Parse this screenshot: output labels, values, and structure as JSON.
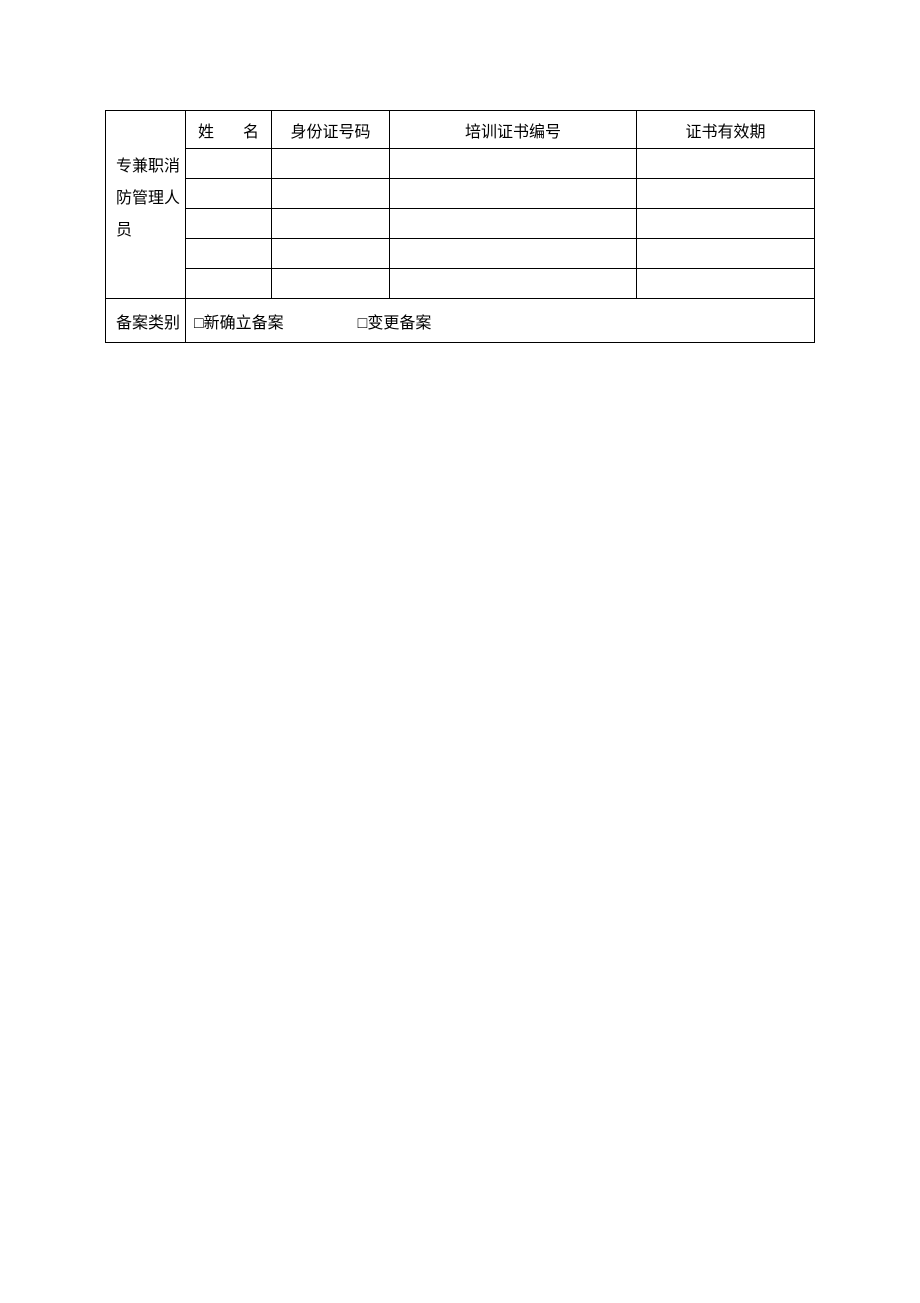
{
  "table": {
    "row_label": "专兼职消防管理人员",
    "headers": {
      "name_char1": "姓",
      "name_char2": "名",
      "id_number": "身份证号码",
      "cert_number": "培训证书编号",
      "cert_validity": "证书有效期"
    },
    "rows": [
      {
        "name": "",
        "id": "",
        "cert": "",
        "valid": ""
      },
      {
        "name": "",
        "id": "",
        "cert": "",
        "valid": ""
      },
      {
        "name": "",
        "id": "",
        "cert": "",
        "valid": ""
      },
      {
        "name": "",
        "id": "",
        "cert": "",
        "valid": ""
      },
      {
        "name": "",
        "id": "",
        "cert": "",
        "valid": ""
      }
    ],
    "filing_label": "备案类别",
    "filing_option1": "□新确立备案",
    "filing_option2": "□变更备案"
  }
}
